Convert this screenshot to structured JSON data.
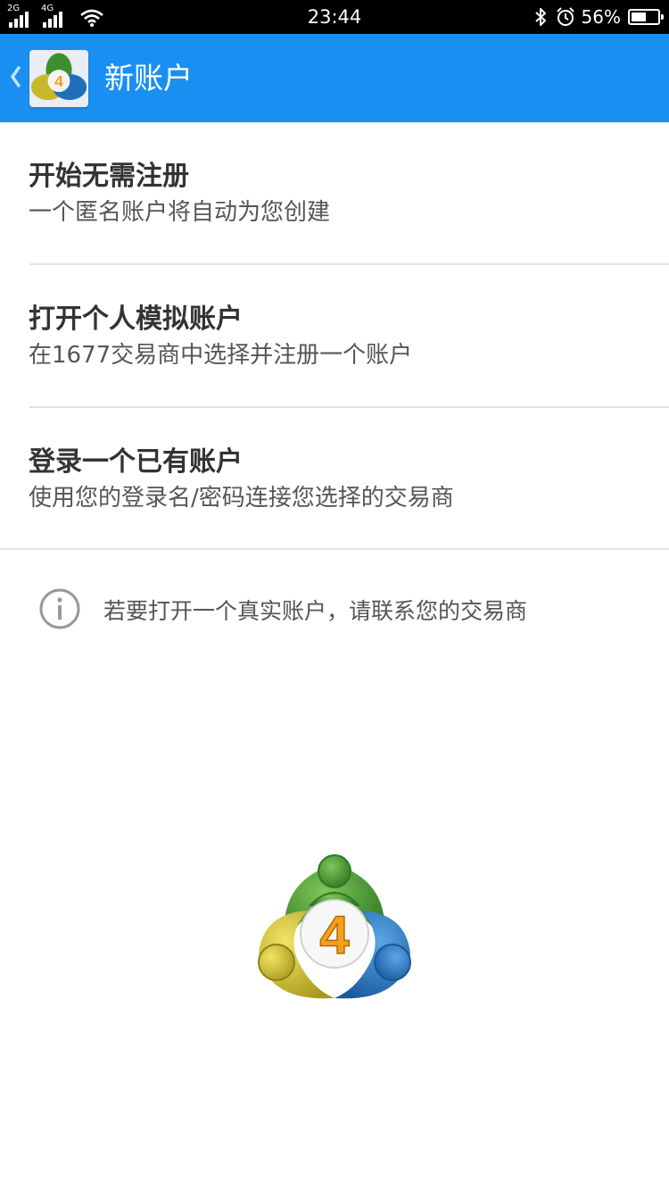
{
  "status_bar": {
    "time": "23:44",
    "battery_percent": "56%",
    "battery_level": 0.56,
    "networks": [
      "2G",
      "4G"
    ],
    "icons": [
      "signal-icon",
      "wifi-icon",
      "bluetooth-icon",
      "alarm-icon",
      "battery-icon"
    ]
  },
  "app_bar": {
    "title": "新账户",
    "background_color": "#1a8ff2",
    "icons": [
      "back-chevron-icon",
      "metatrader-logo-icon"
    ]
  },
  "options": [
    {
      "title": "开始无需注册",
      "subtitle": "一个匿名账户将自动为您创建"
    },
    {
      "title": "打开个人模拟账户",
      "subtitle": "在1677交易商中选择并注册一个账户"
    },
    {
      "title": "登录一个已有账户",
      "subtitle": "使用您的登录名/密码连接您选择的交易商"
    }
  ],
  "info": {
    "text": "若要打开一个真实账户，请联系您的交易商",
    "icon": "info-icon"
  },
  "logo": {
    "label": "4",
    "icon": "metatrader-4-logo-icon",
    "colors": {
      "green": "#3d8f2c",
      "blue": "#1f6fba",
      "yellow": "#c9b82a",
      "accent": "#f2a01e"
    }
  }
}
